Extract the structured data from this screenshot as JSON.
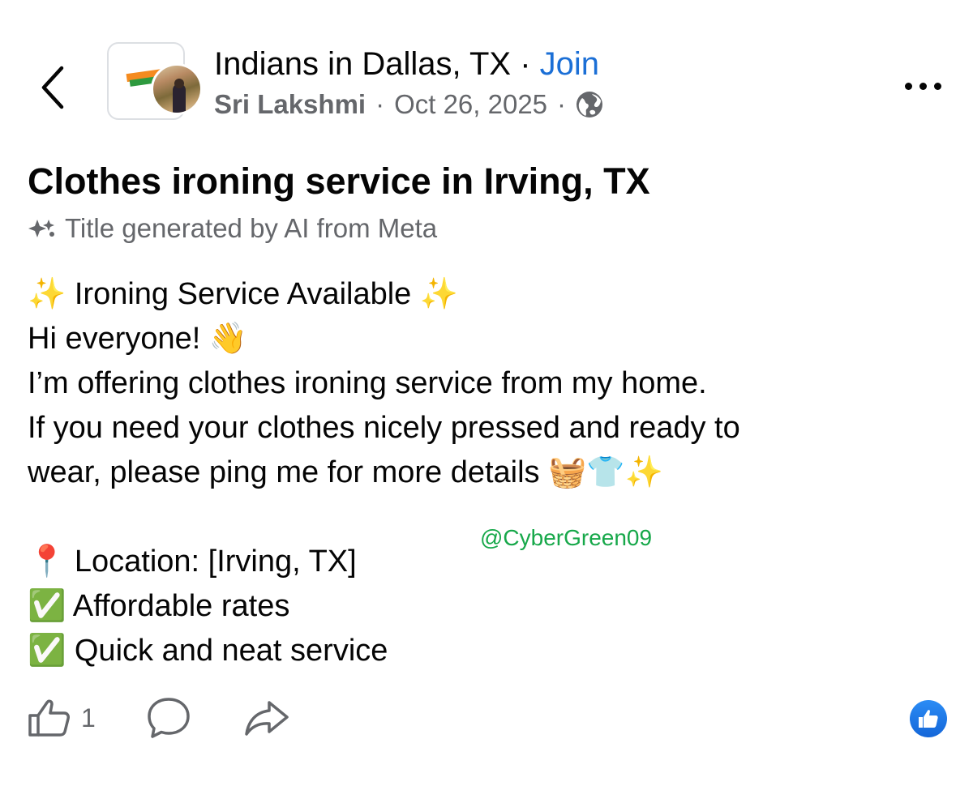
{
  "header": {
    "group_name": "Indians in Dallas, TX",
    "separator": " · ",
    "join_label": "Join",
    "author": "Sri Lakshmi",
    "date": "Oct 26, 2025",
    "dot": "·",
    "back_icon": "chevron-left-icon",
    "more_icon": "more-horizontal-icon",
    "privacy_icon": "globe-icon"
  },
  "post": {
    "title": "Clothes ironing service in Irving, TX",
    "ai_note": "Title generated by AI from Meta",
    "lines": [
      "✨ Ironing Service Available ✨",
      "Hi everyone! 👋",
      "I’m offering clothes ironing service from my home.",
      "If you need your clothes nicely pressed and ready to",
      "wear, please ping me for more details 🧺👕✨",
      "",
      "📍 Location: [Irving, TX]",
      "✅ Affordable rates",
      "✅ Quick and neat service"
    ],
    "watermark": "@CyberGreen09"
  },
  "actions": {
    "like_count": "1",
    "like_icon": "thumbs-up-icon",
    "comment_icon": "comment-icon",
    "share_icon": "share-icon",
    "reaction_icon": "like-reaction-icon"
  },
  "colors": {
    "link_blue": "#1b6fd6",
    "secondary_text": "#65676b",
    "watermark_green": "#17a84a",
    "reaction_blue": "#1877f2"
  }
}
